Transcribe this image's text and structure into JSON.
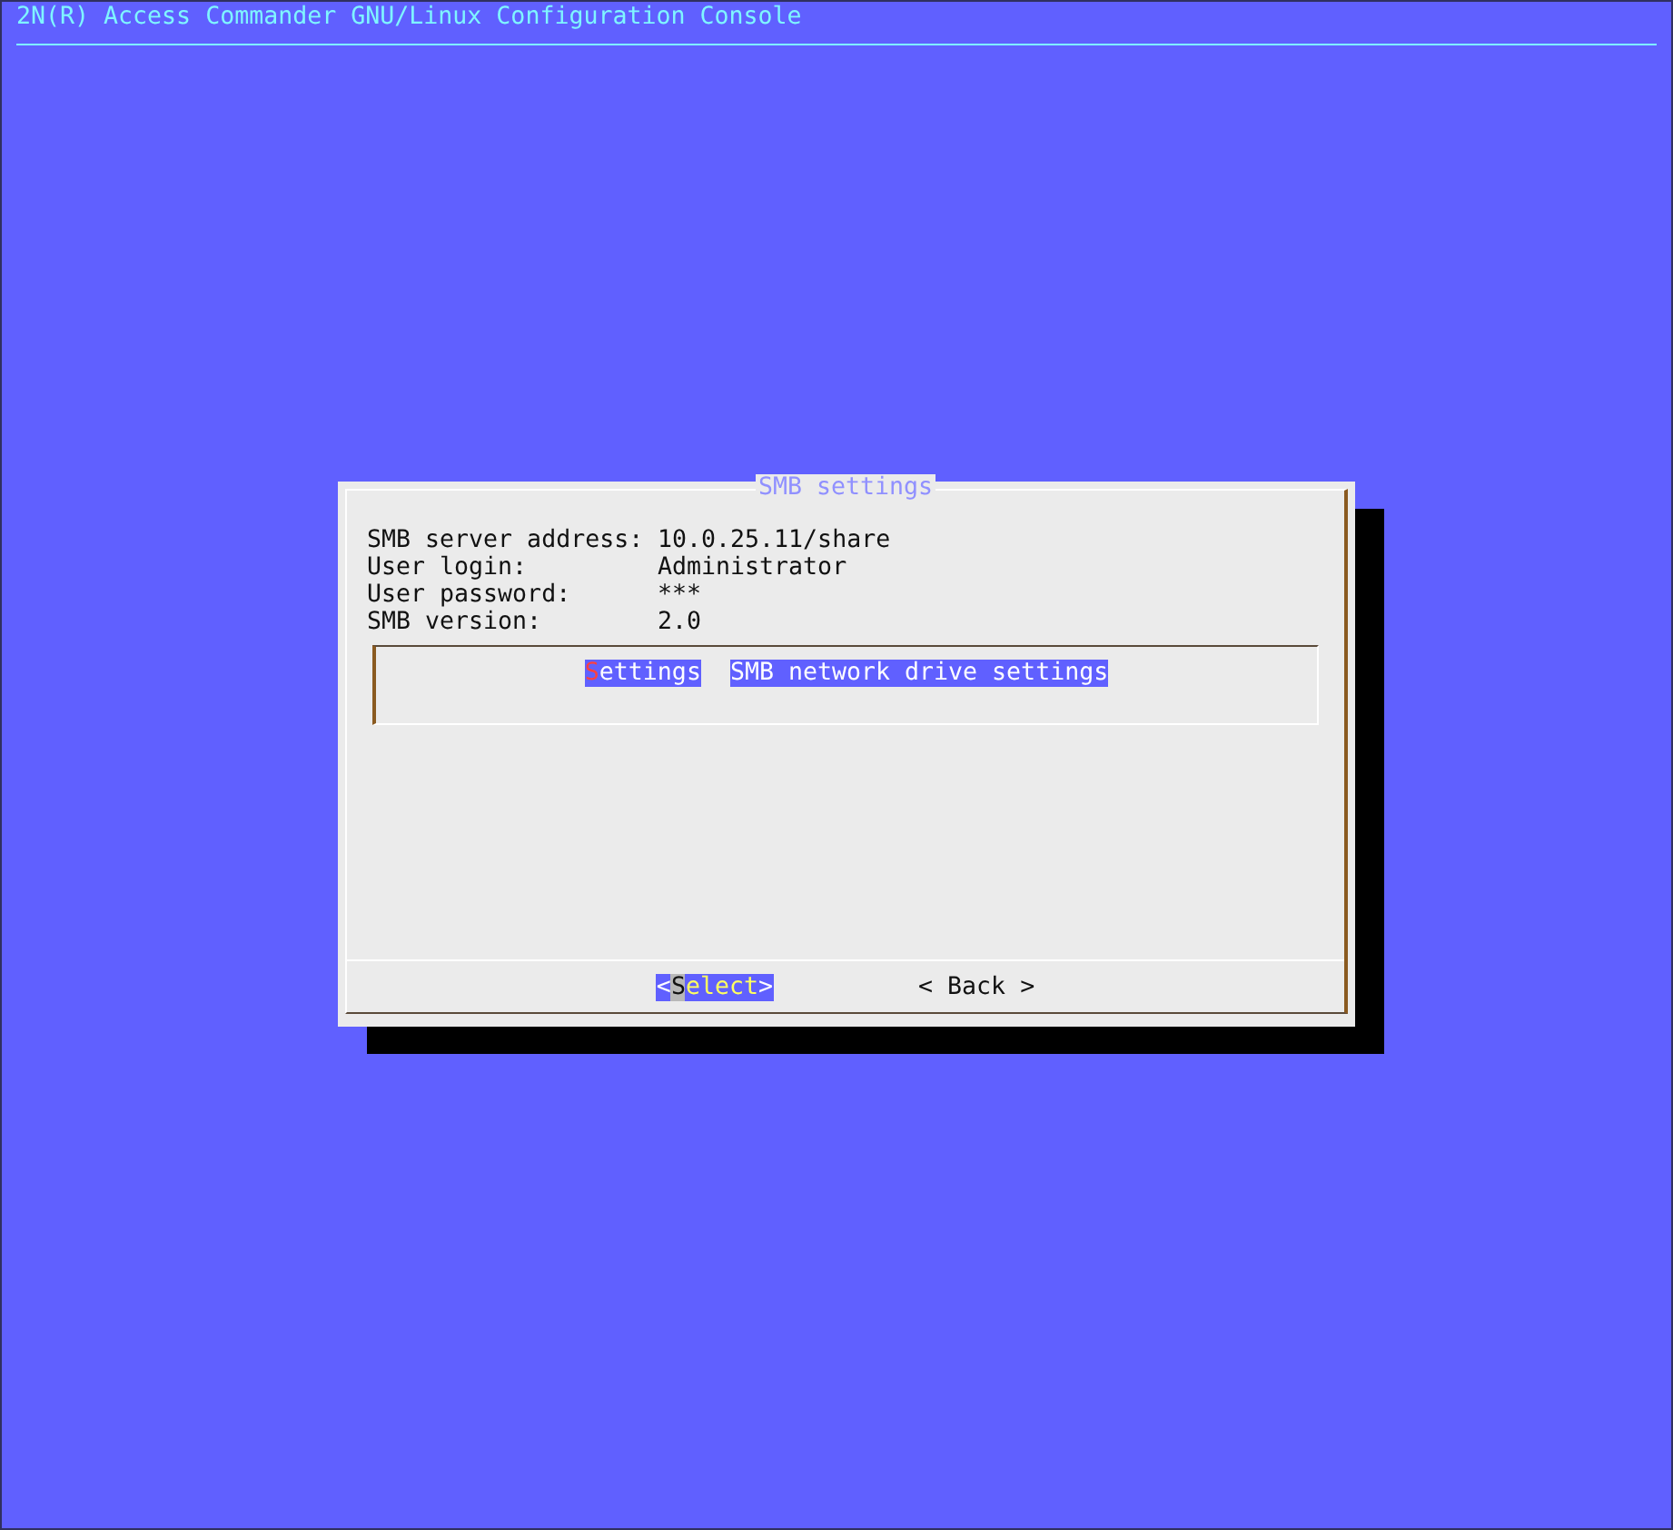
{
  "header": {
    "title": "2N(R) Access Commander GNU/Linux Configuration Console"
  },
  "dialog": {
    "title": "SMB settings",
    "fields": [
      {
        "label": "SMB server address:",
        "value": "10.0.25.11/share"
      },
      {
        "label": "User login:",
        "value": "Administrator"
      },
      {
        "label": "User password:",
        "value": "***"
      },
      {
        "label": "SMB version:",
        "value": "2.0"
      }
    ],
    "menu": [
      {
        "tag": "Settings",
        "description": "SMB network drive settings",
        "selected": true
      }
    ],
    "buttons": [
      {
        "label": "<Select>",
        "selected": true
      },
      {
        "label": "< Back >",
        "selected": false
      }
    ]
  }
}
